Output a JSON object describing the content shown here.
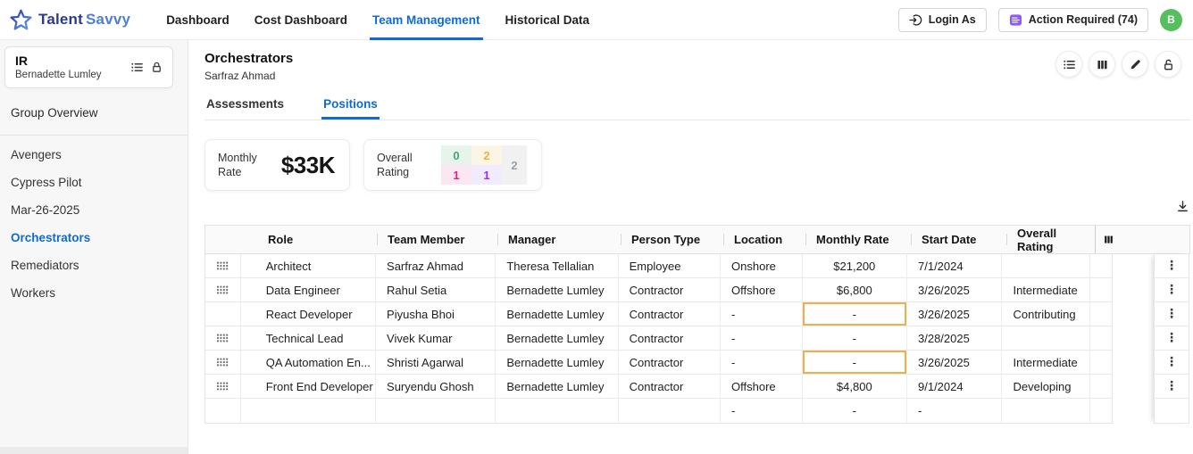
{
  "topbar": {
    "brand": {
      "primary": "Talent",
      "secondary": "Savvy"
    },
    "nav": [
      {
        "label": "Dashboard",
        "active": false
      },
      {
        "label": "Cost Dashboard",
        "active": false
      },
      {
        "label": "Team Management",
        "active": true
      },
      {
        "label": "Historical Data",
        "active": false
      }
    ],
    "login_as_button": "Login As",
    "action_required_button": "Action Required (74)",
    "avatar_initial": "B"
  },
  "sidebar": {
    "group_card": {
      "title": "IR",
      "subtitle": "Bernadette Lumley"
    },
    "overview_label": "Group Overview",
    "items": [
      {
        "label": "Avengers",
        "active": false
      },
      {
        "label": "Cypress Pilot",
        "active": false
      },
      {
        "label": "Mar-26-2025",
        "active": false
      },
      {
        "label": "Orchestrators",
        "active": true
      },
      {
        "label": "Remediators",
        "active": false
      },
      {
        "label": "Workers",
        "active": false
      }
    ]
  },
  "main": {
    "title": "Orchestrators",
    "subtitle": "Sarfraz Ahmad",
    "tabs": [
      {
        "label": "Assessments",
        "active": false
      },
      {
        "label": "Positions",
        "active": true
      }
    ],
    "cards": {
      "monthly_rate": {
        "label": "Monthly Rate",
        "value": "$33K"
      },
      "overall_rating": {
        "label": "Overall Rating",
        "grid": [
          {
            "value": "0",
            "text_color": "#45a471",
            "bg_color": "#e7f4ec"
          },
          {
            "value": "2",
            "text_color": "#eeb04b",
            "bg_color": "#fcf5e3"
          },
          {
            "value": "1",
            "text_color": "#e0218a",
            "bg_color": "#fbe7f2"
          },
          {
            "value": "1",
            "text_color": "#9333ea",
            "bg_color": "#f2eafd"
          },
          {
            "value": "2",
            "text_color": "#9aa1a9",
            "bg_color": "#f1f1f2"
          }
        ]
      }
    },
    "table": {
      "headers": [
        "Role",
        "Team Member",
        "Manager",
        "Person Type",
        "Location",
        "Monthly Rate",
        "Start Date",
        "Overall Rating"
      ],
      "rows": [
        {
          "role": "Architect",
          "member": "Sarfraz Ahmad",
          "manager": "Theresa Tellalian",
          "person_type": "Employee",
          "location": "Onshore",
          "monthly_rate": "$21,200",
          "start_date": "7/1/2024",
          "overall_rating": "",
          "draggable": true,
          "rate_highlighted": false
        },
        {
          "role": "Data Engineer",
          "member": "Rahul Setia",
          "manager": "Bernadette Lumley",
          "person_type": "Contractor",
          "location": "Offshore",
          "monthly_rate": "$6,800",
          "start_date": "3/26/2025",
          "overall_rating": "Intermediate",
          "draggable": true,
          "rate_highlighted": false
        },
        {
          "role": "React Developer",
          "member": "Piyusha Bhoi",
          "manager": "Bernadette Lumley",
          "person_type": "Contractor",
          "location": "-",
          "monthly_rate": "-",
          "start_date": "3/26/2025",
          "overall_rating": "Contributing",
          "draggable": false,
          "rate_highlighted": true
        },
        {
          "role": "Technical Lead",
          "member": "Vivek Kumar",
          "manager": "Bernadette Lumley",
          "person_type": "Contractor",
          "location": "-",
          "monthly_rate": "-",
          "start_date": "3/28/2025",
          "overall_rating": "",
          "draggable": true,
          "rate_highlighted": false
        },
        {
          "role": "QA Automation En...",
          "member": "Shristi Agarwal",
          "manager": "Bernadette Lumley",
          "person_type": "Contractor",
          "location": "-",
          "monthly_rate": "-",
          "start_date": "3/26/2025",
          "overall_rating": "Intermediate",
          "draggable": true,
          "rate_highlighted": true
        },
        {
          "role": "Front End Developer",
          "member": "Suryendu Ghosh",
          "manager": "Bernadette Lumley",
          "person_type": "Contractor",
          "location": "Offshore",
          "monthly_rate": "$4,800",
          "start_date": "9/1/2024",
          "overall_rating": "Developing",
          "draggable": true,
          "rate_highlighted": false
        },
        {
          "role": "",
          "member": "",
          "manager": "",
          "person_type": "",
          "location": "-",
          "monthly_rate": "-",
          "start_date": "-",
          "overall_rating": "",
          "draggable": false,
          "rate_highlighted": false
        }
      ]
    }
  },
  "colors": {
    "accent_blue": "#0f6bd2",
    "highlight_orange": "#e9b24c",
    "avatar_green": "#55bf5e",
    "action_icon_purple": "#8b5cf6"
  }
}
